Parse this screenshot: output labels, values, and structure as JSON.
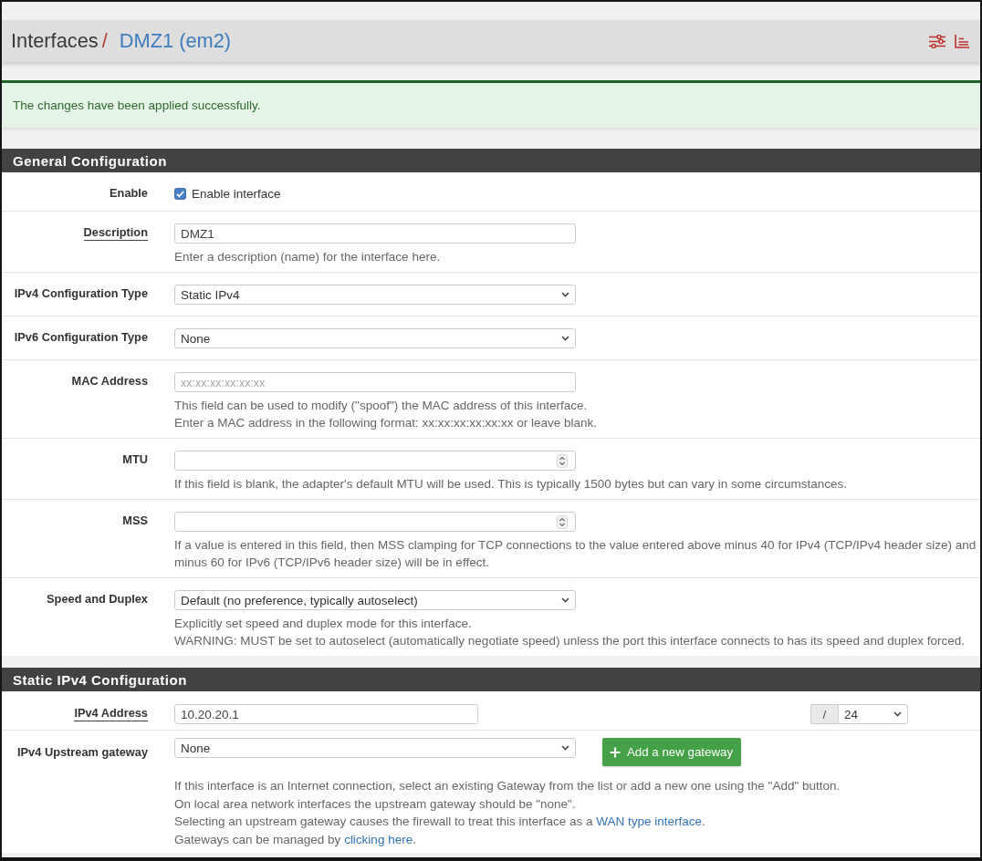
{
  "header": {
    "breadcrumb": [
      {
        "text": "Interfaces",
        "link": false
      },
      {
        "text": "DMZ1 (em2)",
        "link": true
      }
    ],
    "separator": "/"
  },
  "alert": {
    "kind": "success",
    "text": "The changes have been applied successfully."
  },
  "sections": [
    {
      "title": "General Configuration",
      "rows": [
        {
          "kind": "checkbox",
          "label": "Enable",
          "required": false,
          "checked": true,
          "text": "Enable interface"
        },
        {
          "kind": "text",
          "label": "Description",
          "required": true,
          "value": "DMZ1",
          "help": [
            {
              "text": "Enter a description (name) for the interface here."
            }
          ]
        },
        {
          "kind": "select",
          "label": "IPv4 Configuration Type",
          "required": false,
          "value": "Static IPv4"
        },
        {
          "kind": "select",
          "label": "IPv6 Configuration Type",
          "required": false,
          "value": "None"
        },
        {
          "kind": "text",
          "label": "MAC Address",
          "required": false,
          "placeholder": "xx:xx:xx:xx:xx:xx",
          "help": [
            {
              "text": "This field can be used to modify (\"spoof\") the MAC address of this interface."
            },
            {
              "text": "Enter a MAC address in the following format: xx:xx:xx:xx:xx:xx or leave blank."
            }
          ]
        },
        {
          "kind": "number",
          "label": "MTU",
          "required": false,
          "help": [
            {
              "text": "If this field is blank, the adapter's default MTU will be used. This is typically 1500 bytes but can vary in some circumstances."
            }
          ]
        },
        {
          "kind": "number",
          "label": "MSS",
          "required": false,
          "help": [
            {
              "text": "If a value is entered in this field, then MSS clamping for TCP connections to the value entered above minus 40 for IPv4 (TCP/IPv4 header size) and minus 60 for IPv6 (TCP/IPv6 header size) will be in effect."
            }
          ]
        },
        {
          "kind": "select",
          "label": "Speed and Duplex",
          "required": false,
          "value": "Default (no preference, typically autoselect)",
          "help": [
            {
              "text": "Explicitly set speed and duplex mode for this interface."
            },
            {
              "text": "WARNING: MUST be set to autoselect (automatically negotiate speed) unless the port this interface connects to has its speed and duplex forced."
            }
          ]
        }
      ]
    },
    {
      "title": "Static IPv4 Configuration",
      "rows": [
        {
          "kind": "cidr",
          "label": "IPv4 Address",
          "required": true,
          "value": "10.20.20.1",
          "separator": "/",
          "mask": "24"
        },
        {
          "kind": "select",
          "label": "IPv4 Upstream gateway",
          "required": false,
          "value": "None",
          "button": {
            "text": "Add a new gateway"
          },
          "help": [
            {
              "text": "If this interface is an Internet connection, select an existing Gateway from the list or add a new one using the \"Add\" button."
            },
            {
              "text": "On local area network interfaces the upstream gateway should be \"none\"."
            },
            {
              "text": "Selecting an upstream gateway causes the firewall to treat this interface as a ",
              "link": "WAN type interface",
              "after": "."
            },
            {
              "text": "Gateways can be managed by ",
              "link": "clicking here",
              "after": "."
            }
          ]
        }
      ]
    }
  ]
}
